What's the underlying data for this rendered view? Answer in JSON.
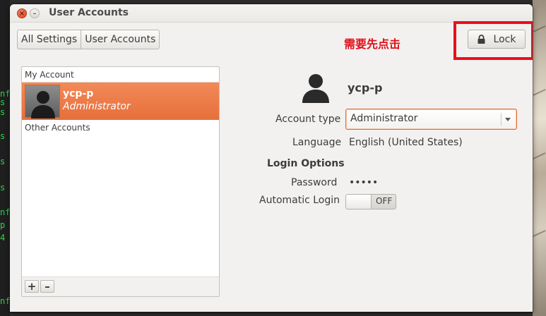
{
  "terminal": {
    "lines": [
      "nf",
      "s",
      "s",
      "",
      "s",
      "",
      "s",
      "",
      "s",
      "",
      "nf",
      "p",
      "4",
      "",
      "",
      "nf"
    ]
  },
  "window": {
    "title": "User Accounts",
    "close_icon": "×",
    "minimize_icon": "–"
  },
  "breadcrumb": {
    "items": [
      "All Settings",
      "User Accounts"
    ]
  },
  "note": "需要先点击",
  "lock": {
    "label": "Lock",
    "icon": "lock-icon"
  },
  "users": {
    "my_account_header": "My Account",
    "other_accounts_header": "Other Accounts",
    "selected": {
      "name": "ycp-p",
      "role": "Administrator"
    },
    "add_label": "+",
    "remove_label": "–"
  },
  "details": {
    "name": "ycp-p",
    "account_type_label": "Account type",
    "account_type_value": "Administrator",
    "language_label": "Language",
    "language_value": "English (United States)",
    "login_options_heading": "Login Options",
    "password_label": "Password",
    "password_value": "•••••",
    "auto_login_label": "Automatic Login",
    "auto_login_state": "OFF"
  },
  "colors": {
    "accent": "#e66f3b",
    "highlight_red": "#e8101a",
    "terminal_green": "#2fd34a"
  }
}
